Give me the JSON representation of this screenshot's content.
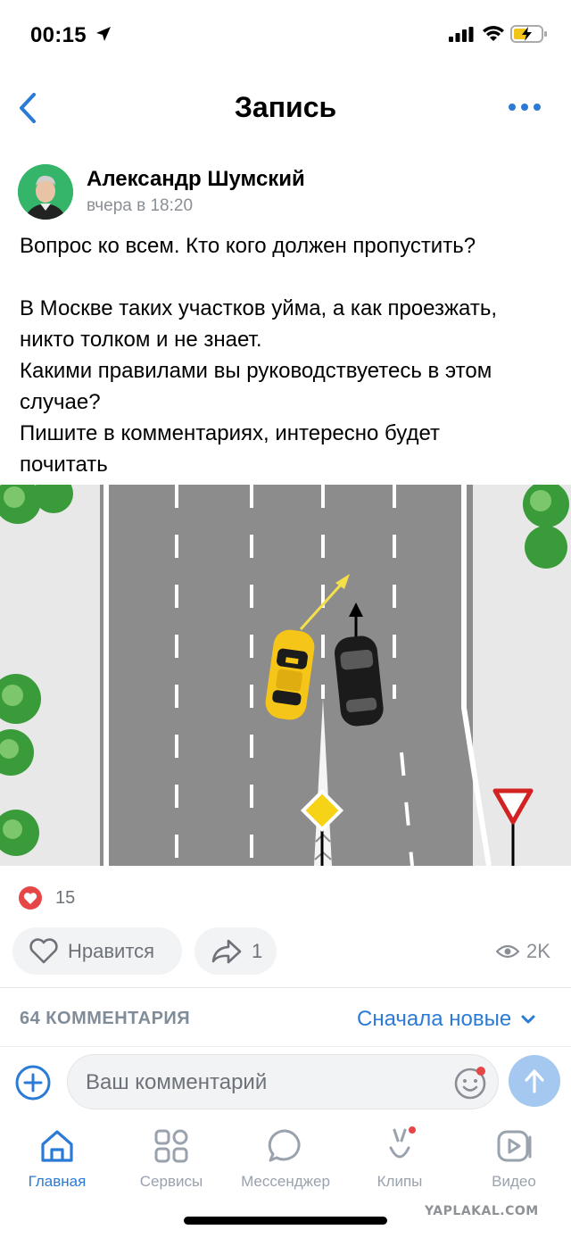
{
  "status": {
    "time": "00:15",
    "icons": [
      "location-arrow-icon",
      "signal-icon",
      "wifi-icon",
      "battery-charging-icon"
    ]
  },
  "header": {
    "title": "Запись",
    "back_icon": "chevron-left-icon",
    "more_icon": "more-horizontal-icon"
  },
  "post": {
    "author": "Александр Шумский",
    "time": "вчера в 18:20",
    "text": [
      "Вопрос ко всем. Кто кого должен пропустить?",
      "",
      "В Москве таких участков уйма, а как проезжать,",
      "никто толком и не знает.",
      "Какими правилами вы руководствуетесь в этом",
      "случае?",
      "Пишите в комментариях, интересно будет",
      "почитать"
    ],
    "reactions_count": "15",
    "like_label": "Нравится",
    "share_count": "1",
    "views": "2K"
  },
  "comments": {
    "count_label": "64 КОММЕНТАРИЯ",
    "sort_label": "Сначала новые",
    "placeholder": "Ваш комментарий"
  },
  "tabs": [
    {
      "label": "Главная",
      "icon": "home-icon",
      "active": true
    },
    {
      "label": "Сервисы",
      "icon": "services-grid-icon",
      "active": false
    },
    {
      "label": "Мессенджер",
      "icon": "messenger-icon",
      "active": false
    },
    {
      "label": "Клипы",
      "icon": "clips-icon",
      "active": false
    },
    {
      "label": "Видео",
      "icon": "video-icon",
      "active": false
    }
  ],
  "watermark": "YAPLAKAL.COM",
  "colors": {
    "accent": "#2b7bd6",
    "muted": "#818c99",
    "like_red": "#e64646",
    "avatar_bg": "#35b56a",
    "road": "#888888",
    "taxi": "#f5c518",
    "black_car": "#1b1b1b"
  }
}
